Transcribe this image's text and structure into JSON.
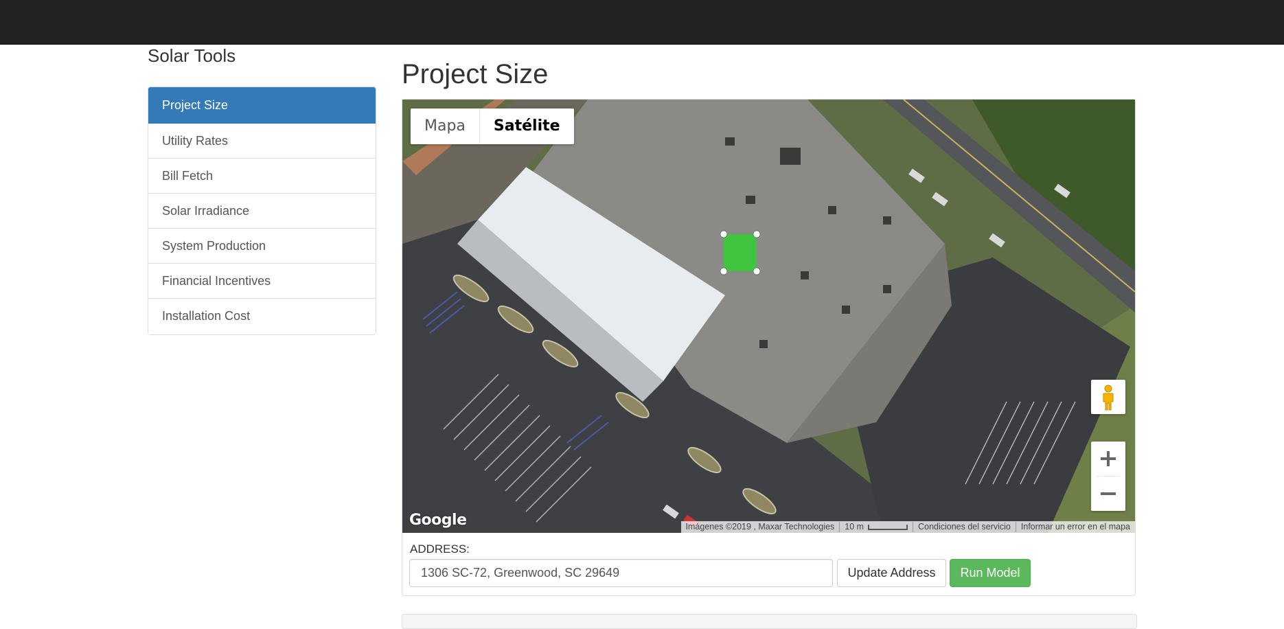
{
  "sidebar": {
    "title": "Solar Tools",
    "items": [
      {
        "label": "Project Size",
        "active": true
      },
      {
        "label": "Utility Rates"
      },
      {
        "label": "Bill Fetch"
      },
      {
        "label": "Solar Irradiance"
      },
      {
        "label": "System Production"
      },
      {
        "label": "Financial Incentives"
      },
      {
        "label": "Installation Cost"
      }
    ]
  },
  "main": {
    "title": "Project Size",
    "map": {
      "type_controls": {
        "map": "Mapa",
        "satellite": "Satélite",
        "selected": "Satélite"
      },
      "zoom_in": "+",
      "zoom_out": "−",
      "logo": "Google",
      "attribution": {
        "imagery": "Imágenes ©2019 , Maxar Technologies",
        "scale": "10 m",
        "terms": "Condiciones del servicio",
        "report": "Informar un error en el mapa"
      },
      "icons": [
        "pegman-icon",
        "zoom-in-icon",
        "zoom-out-icon"
      ]
    },
    "address": {
      "label": "ADDRESS:",
      "value": "1306 SC-72, Greenwood, SC 29649",
      "update_button": "Update Address",
      "run_button": "Run Model"
    }
  },
  "colors": {
    "navbar": "#222222",
    "active_nav": "#337ab7",
    "run_button": "#5cb85c",
    "selection_polygon": "#33cc33"
  }
}
